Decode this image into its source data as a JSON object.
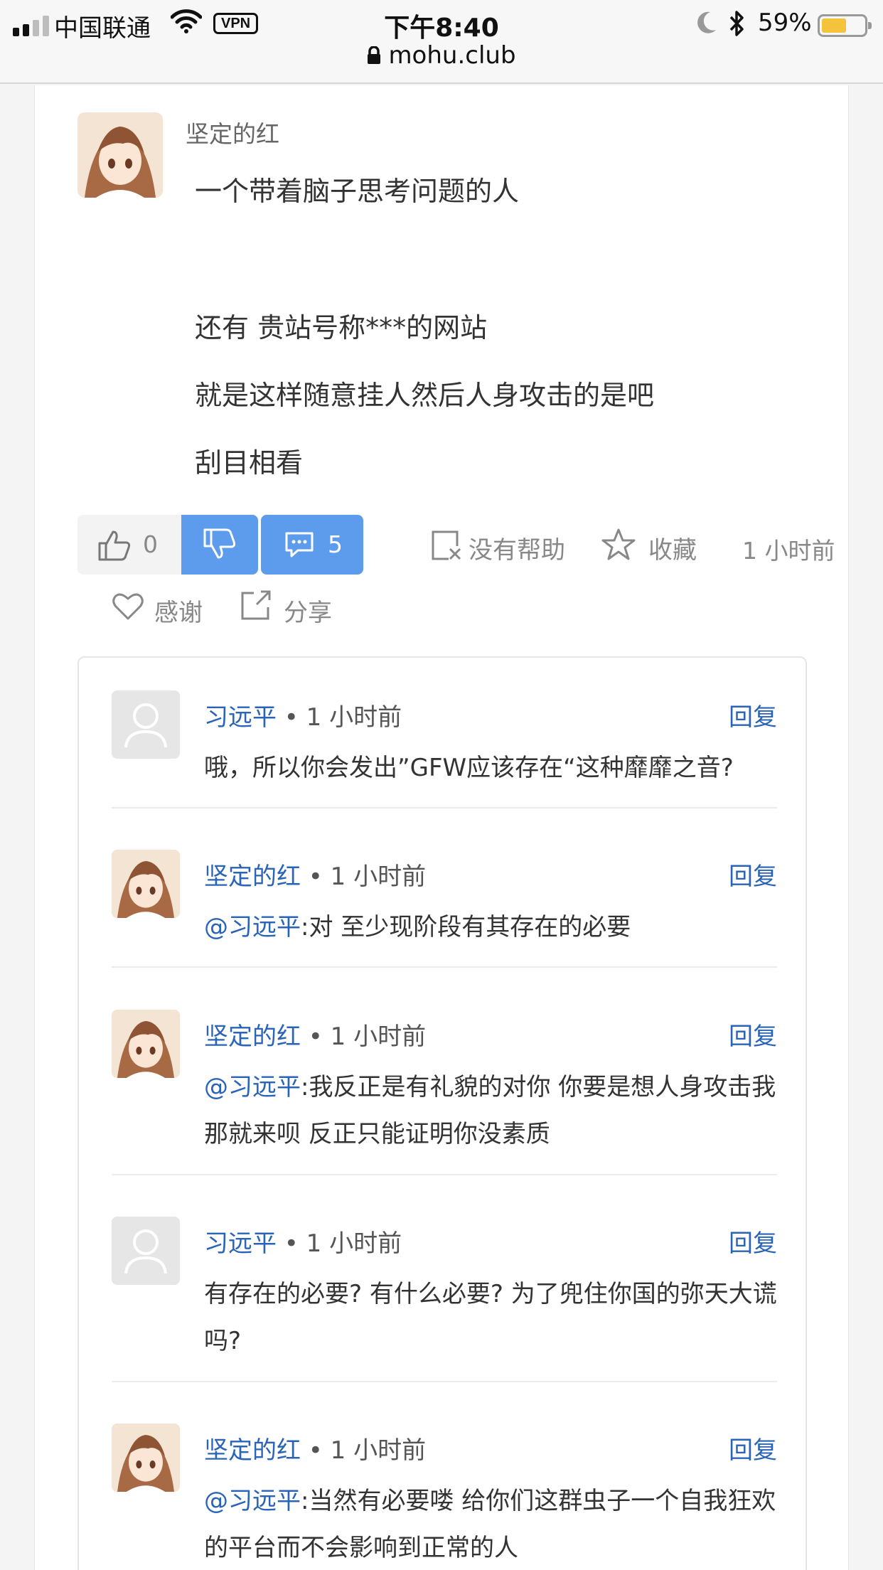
{
  "status_bar": {
    "carrier": "中国联通",
    "vpn": "VPN",
    "time": "下午8:40",
    "battery": "59%",
    "battery_level": 0.59,
    "url": "mohu.club"
  },
  "post": {
    "author": "坚定的红",
    "lines": [
      "一个带着脑子思考问题的人",
      "还有 贵站号称***的网站",
      "就是这样随意挂人然后人身攻击的是吧",
      "刮目相看"
    ]
  },
  "actions": {
    "like_count": "0",
    "comment_count": "5",
    "not_helpful": "没有帮助",
    "favorite": "收藏",
    "time": "1 小时前",
    "thanks": "感谢",
    "share": "分享"
  },
  "comments": [
    {
      "user": "习远平",
      "meta": " • 1 小时前",
      "reply": "回复",
      "mention": "",
      "text": "哦，所以你会发出”GFW应该存在“这种靡靡之音?",
      "avatar": "default-avatar"
    },
    {
      "user": "坚定的红",
      "meta": " • 1 小时前",
      "reply": "回复",
      "mention": "@习远平",
      "text": ":对 至少现阶段有其存在的必要",
      "avatar": "anime-avatar"
    },
    {
      "user": "坚定的红",
      "meta": " • 1 小时前",
      "reply": "回复",
      "mention": "@习远平",
      "text": ":我反正是有礼貌的对你 你要是想人身攻击我 那就来呗 反正只能证明你没素质",
      "avatar": "anime-avatar"
    },
    {
      "user": "习远平",
      "meta": " • 1 小时前",
      "reply": "回复",
      "mention": "",
      "text": "有存在的必要? 有什么必要? 为了兜住你国的弥天大谎吗?",
      "avatar": "default-avatar"
    },
    {
      "user": "坚定的红",
      "meta": " • 1 小时前",
      "reply": "回复",
      "mention": "@习远平",
      "text": ":当然有必要喽 给你们这群虫子一个自我狂欢的平台而不会影响到正常的人",
      "avatar": "anime-avatar"
    }
  ],
  "colors": {
    "accent": "#5d9cec",
    "link": "#2a64b8",
    "battery": "#f5c33b"
  }
}
